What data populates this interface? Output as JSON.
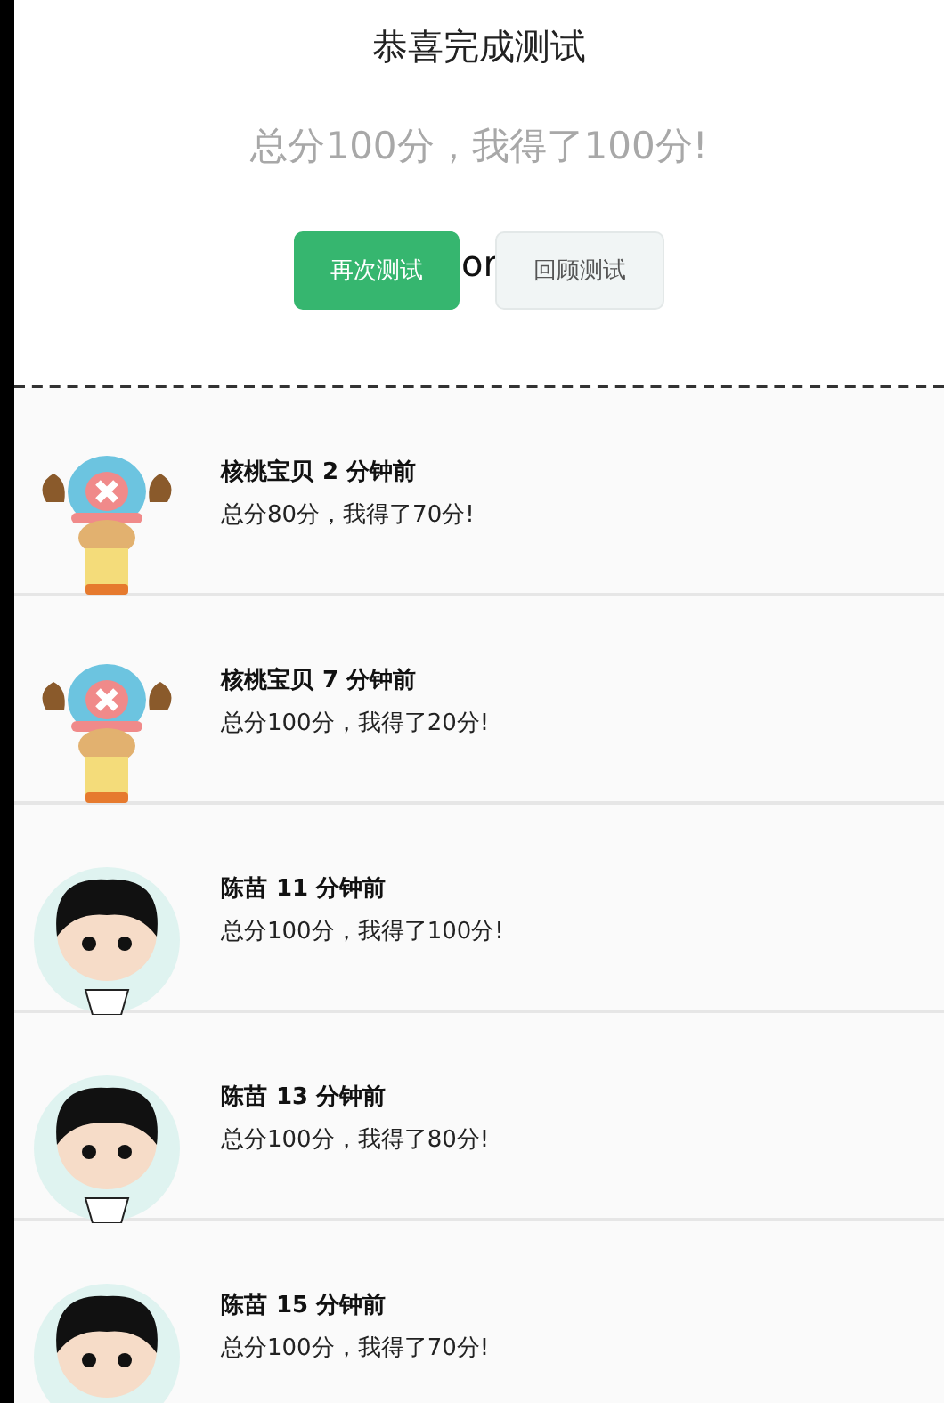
{
  "header": {
    "title": "恭喜完成测试",
    "score": "总分100分，我得了100分!",
    "buttons": [
      {
        "label": "再次测试",
        "kind": "primary"
      },
      {
        "label": "回顾测试",
        "kind": "secondary"
      }
    ],
    "separator": "or"
  },
  "records": [
    {
      "avatar": {
        "kind": "deer"
      },
      "name": "核桃宝贝",
      "time": "2 分钟前",
      "result": "总分80分，我得了70分!"
    },
    {
      "avatar": {
        "kind": "deer"
      },
      "name": "核桃宝贝",
      "time": "7 分钟前",
      "result": "总分100分，我得了20分!"
    },
    {
      "avatar": {
        "kind": "boy"
      },
      "name": "陈苗",
      "time": "11 分钟前",
      "result": "总分100分，我得了100分!"
    },
    {
      "avatar": {
        "kind": "boy"
      },
      "name": "陈苗",
      "time": "13 分钟前",
      "result": "总分100分，我得了80分!"
    },
    {
      "avatar": {
        "kind": "boy"
      },
      "name": "陈苗",
      "time": "15 分钟前",
      "result": "总分100分，我得了70分!"
    }
  ]
}
